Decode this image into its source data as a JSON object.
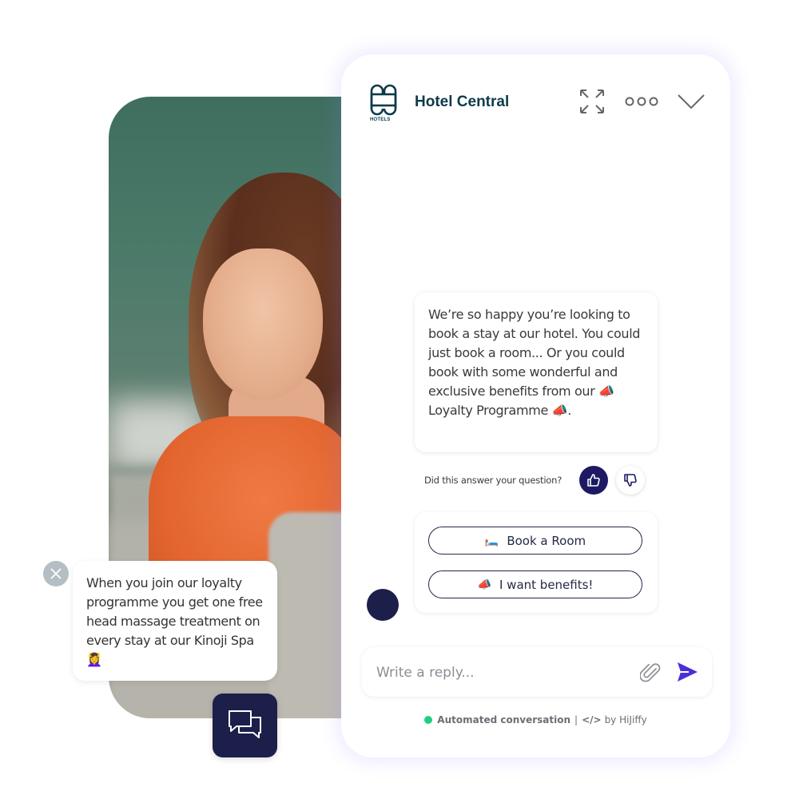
{
  "photo": {
    "alt": "smiling woman in orange blouse"
  },
  "header": {
    "brand_name": "Hotel Central",
    "logo_caption": "HOTELS",
    "icons": {
      "expand": "expand-icon",
      "more": "more-options-icon",
      "collapse": "chevron-down-icon"
    }
  },
  "conversation": {
    "bot_message": "We’re so happy you’re looking to book a stay at our hotel. You could just book a room... Or you could book with some wonderful and exclusive benefits from our 📣 Loyalty Programme 📣.",
    "feedback": {
      "question": "Did this answer your question?",
      "selected": "thumbs-up"
    },
    "quick_replies": [
      {
        "emoji": "🛏️",
        "label": "Book a Room"
      },
      {
        "emoji": "📣",
        "label": "I want benefits!"
      }
    ]
  },
  "composer": {
    "placeholder": "Write a reply...",
    "value": ""
  },
  "footer": {
    "status": "Automated conversation",
    "separator": "|",
    "code_glyph": "</>",
    "powered_by": "by HiJiffy",
    "status_color": "#1fcf86"
  },
  "promo": {
    "message": "When you join our loyalty programme you get one free head massage treatment on every stay at our Kinoji Spa 💆‍♀️"
  },
  "colors": {
    "brand_dark": "#0d3b4a",
    "navy": "#1c1f4a",
    "thumb_active": "#1d1a63",
    "send": "#4b2fd6"
  }
}
